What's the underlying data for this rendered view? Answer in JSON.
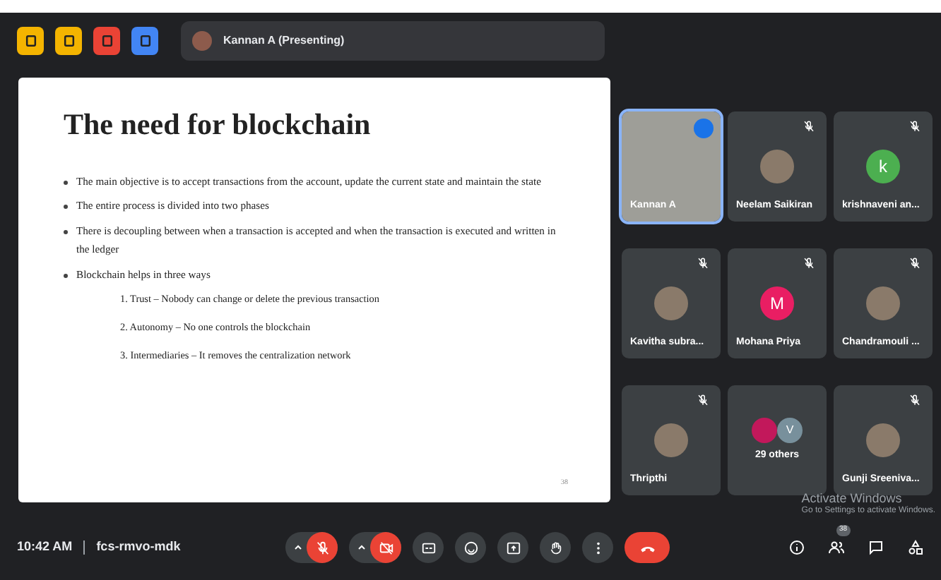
{
  "top_bar": {
    "apps": [
      {
        "color": "#f4b400"
      },
      {
        "color": "#f4b400"
      },
      {
        "color": "#ea4335"
      },
      {
        "color": "#4285f4"
      }
    ],
    "presenter": "Kannan A (Presenting)"
  },
  "slide": {
    "title": "The need for blockchain",
    "bullets": [
      {
        "text": "The main objective is to accept transactions from the account, update the current state and maintain the state"
      },
      {
        "text": "The entire process is divided into two phases"
      },
      {
        "text": "There is decoupling between when a transaction is accepted and when the transaction is executed and written in the ledger"
      },
      {
        "text": "Blockchain helps in three ways",
        "children": [
          {
            "text": "1. Trust – Nobody can change or delete the previous transaction"
          },
          {
            "text": "2. Autonomy – No one controls the blockchain"
          },
          {
            "text": "3. Intermediaries – It removes the centralization network"
          }
        ]
      }
    ],
    "page": "38"
  },
  "participants": [
    {
      "name": "Kannan A",
      "kind": "video",
      "muted": false,
      "speaking": true
    },
    {
      "name": "Neelam Saikiran",
      "kind": "photo",
      "muted": true,
      "speaking": false
    },
    {
      "name": "krishnaveni an...",
      "kind": "letter",
      "letter": "k",
      "color": "#4caf50",
      "muted": true,
      "speaking": false
    },
    {
      "name": "Kavitha subra...",
      "kind": "photo",
      "muted": true,
      "speaking": false
    },
    {
      "name": "Mohana Priya",
      "kind": "letter",
      "letter": "M",
      "color": "#e91e63",
      "muted": true,
      "speaking": false
    },
    {
      "name": "Chandramouli ...",
      "kind": "photo",
      "muted": true,
      "speaking": false
    },
    {
      "name": "Thripthi",
      "kind": "photo",
      "muted": true,
      "speaking": false
    },
    {
      "name": "29 others",
      "kind": "others",
      "letter": "V",
      "muted": false,
      "speaking": false
    },
    {
      "name": "Gunji Sreeniva...",
      "kind": "photo",
      "muted": true,
      "speaking": false
    }
  ],
  "bottom_bar": {
    "time": "10:42 AM",
    "meeting_code": "fcs-rmvo-mdk",
    "mic_on": false,
    "camera_on": false,
    "people_count": "38"
  },
  "os_notice": {
    "title": "Activate Windows",
    "text": "Go to Settings to activate Windows."
  }
}
